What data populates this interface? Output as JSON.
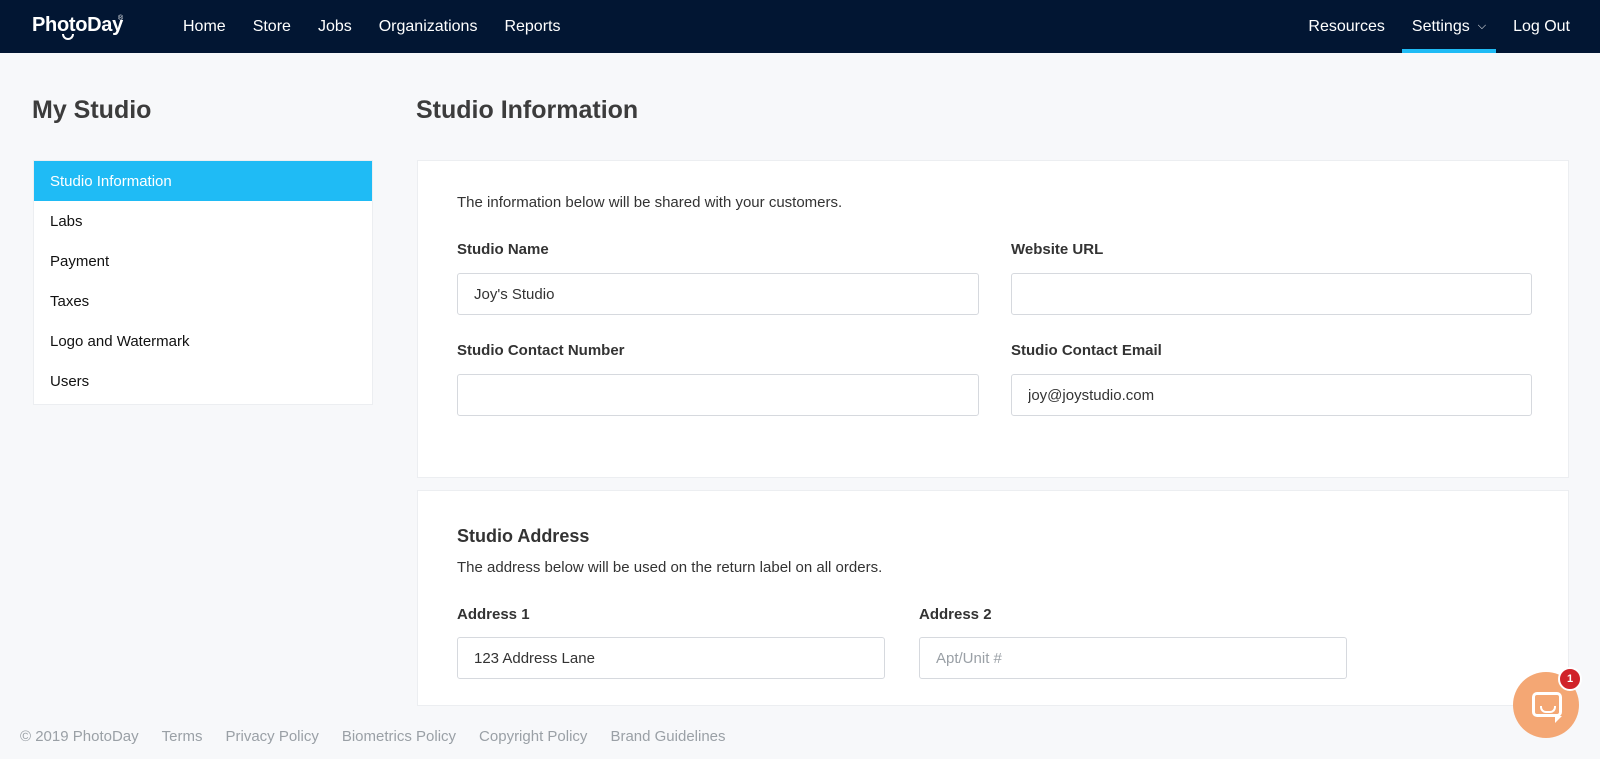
{
  "brand": {
    "name": "PhotoDay",
    "tm": "®"
  },
  "nav": {
    "left": [
      "Home",
      "Store",
      "Jobs",
      "Organizations",
      "Reports"
    ],
    "right": {
      "resources": "Resources",
      "settings": "Settings",
      "logout": "Log Out"
    }
  },
  "sidebar": {
    "title": "My Studio",
    "items": [
      "Studio Information",
      "Labs",
      "Payment",
      "Taxes",
      "Logo and Watermark",
      "Users"
    ],
    "active": "Studio Information"
  },
  "main": {
    "title": "Studio Information",
    "info": {
      "description": "The information below will be shared with your customers.",
      "studio_name_label": "Studio Name",
      "studio_name_value": "Joy's Studio",
      "website_label": "Website URL",
      "website_value": "",
      "contact_number_label": "Studio Contact Number",
      "contact_number_value": "",
      "contact_email_label": "Studio Contact Email",
      "contact_email_value": "joy@joystudio.com"
    },
    "address": {
      "title": "Studio Address",
      "description": "The address below will be used on the return label on all orders.",
      "address1_label": "Address 1",
      "address1_value": "123 Address Lane",
      "address2_label": "Address 2",
      "address2_placeholder": "Apt/Unit #"
    }
  },
  "footer": {
    "copyright": "© 2019 PhotoDay",
    "links": [
      "Terms",
      "Privacy Policy",
      "Biometrics Policy",
      "Copyright Policy",
      "Brand Guidelines"
    ]
  },
  "chat": {
    "icon": "chat-icon",
    "badge_count": "1"
  },
  "colors": {
    "nav_bg": "#021633",
    "accent": "#1fbbf5",
    "chat": "#f4a774",
    "badge": "#d0232a"
  }
}
